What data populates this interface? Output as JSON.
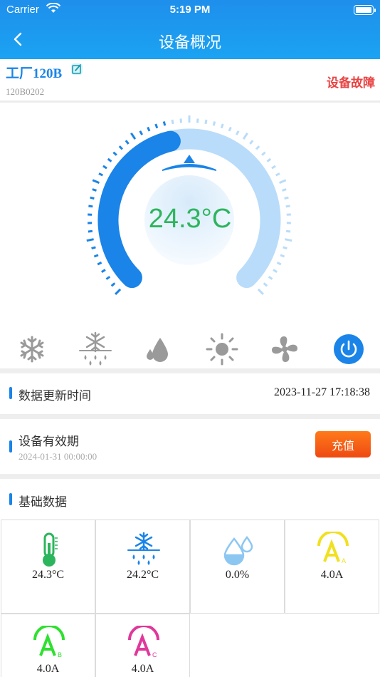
{
  "status_bar": {
    "carrier": "Carrier",
    "time": "5:19 PM"
  },
  "nav": {
    "title": "设备概况"
  },
  "device": {
    "name": "工厂120B",
    "code": "120B0202",
    "status": "设备故障"
  },
  "gauge": {
    "temperature": "24.3°C",
    "fill_fraction": 0.45
  },
  "modes": [
    {
      "icon": "snowflake-icon"
    },
    {
      "icon": "snow-rain-icon"
    },
    {
      "icon": "water-drops-icon"
    },
    {
      "icon": "sun-icon"
    },
    {
      "icon": "fan-icon"
    },
    {
      "icon": "power-icon"
    }
  ],
  "update": {
    "label": "数据更新时间",
    "value": "2023-11-27 17:18:38"
  },
  "validity": {
    "label": "设备有效期",
    "date": "2024-01-31 00:00:00",
    "button": "充值"
  },
  "basic": {
    "title": "基础数据",
    "items": [
      {
        "icon": "thermometer-icon",
        "value": "24.3°C"
      },
      {
        "icon": "snow-rain-icon",
        "value": "24.2°C"
      },
      {
        "icon": "humidity-icon",
        "value": "0.0%"
      },
      {
        "icon": "current-a-icon",
        "value": "4.0A"
      },
      {
        "icon": "current-b-icon",
        "value": "4.0A"
      },
      {
        "icon": "current-c-icon",
        "value": "4.0A"
      }
    ]
  },
  "colors": {
    "primary": "#1a84e8",
    "fault": "#e84545",
    "temperature": "#2db55d",
    "recharge": "#f25a14"
  }
}
